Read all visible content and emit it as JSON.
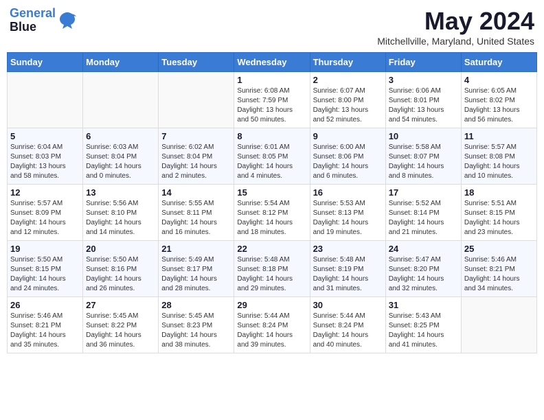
{
  "logo": {
    "line1": "General",
    "line2": "Blue"
  },
  "title": "May 2024",
  "subtitle": "Mitchellville, Maryland, United States",
  "headers": [
    "Sunday",
    "Monday",
    "Tuesday",
    "Wednesday",
    "Thursday",
    "Friday",
    "Saturday"
  ],
  "weeks": [
    [
      {
        "day": "",
        "info": ""
      },
      {
        "day": "",
        "info": ""
      },
      {
        "day": "",
        "info": ""
      },
      {
        "day": "1",
        "info": "Sunrise: 6:08 AM\nSunset: 7:59 PM\nDaylight: 13 hours\nand 50 minutes."
      },
      {
        "day": "2",
        "info": "Sunrise: 6:07 AM\nSunset: 8:00 PM\nDaylight: 13 hours\nand 52 minutes."
      },
      {
        "day": "3",
        "info": "Sunrise: 6:06 AM\nSunset: 8:01 PM\nDaylight: 13 hours\nand 54 minutes."
      },
      {
        "day": "4",
        "info": "Sunrise: 6:05 AM\nSunset: 8:02 PM\nDaylight: 13 hours\nand 56 minutes."
      }
    ],
    [
      {
        "day": "5",
        "info": "Sunrise: 6:04 AM\nSunset: 8:03 PM\nDaylight: 13 hours\nand 58 minutes."
      },
      {
        "day": "6",
        "info": "Sunrise: 6:03 AM\nSunset: 8:04 PM\nDaylight: 14 hours\nand 0 minutes."
      },
      {
        "day": "7",
        "info": "Sunrise: 6:02 AM\nSunset: 8:04 PM\nDaylight: 14 hours\nand 2 minutes."
      },
      {
        "day": "8",
        "info": "Sunrise: 6:01 AM\nSunset: 8:05 PM\nDaylight: 14 hours\nand 4 minutes."
      },
      {
        "day": "9",
        "info": "Sunrise: 6:00 AM\nSunset: 8:06 PM\nDaylight: 14 hours\nand 6 minutes."
      },
      {
        "day": "10",
        "info": "Sunrise: 5:58 AM\nSunset: 8:07 PM\nDaylight: 14 hours\nand 8 minutes."
      },
      {
        "day": "11",
        "info": "Sunrise: 5:57 AM\nSunset: 8:08 PM\nDaylight: 14 hours\nand 10 minutes."
      }
    ],
    [
      {
        "day": "12",
        "info": "Sunrise: 5:57 AM\nSunset: 8:09 PM\nDaylight: 14 hours\nand 12 minutes."
      },
      {
        "day": "13",
        "info": "Sunrise: 5:56 AM\nSunset: 8:10 PM\nDaylight: 14 hours\nand 14 minutes."
      },
      {
        "day": "14",
        "info": "Sunrise: 5:55 AM\nSunset: 8:11 PM\nDaylight: 14 hours\nand 16 minutes."
      },
      {
        "day": "15",
        "info": "Sunrise: 5:54 AM\nSunset: 8:12 PM\nDaylight: 14 hours\nand 18 minutes."
      },
      {
        "day": "16",
        "info": "Sunrise: 5:53 AM\nSunset: 8:13 PM\nDaylight: 14 hours\nand 19 minutes."
      },
      {
        "day": "17",
        "info": "Sunrise: 5:52 AM\nSunset: 8:14 PM\nDaylight: 14 hours\nand 21 minutes."
      },
      {
        "day": "18",
        "info": "Sunrise: 5:51 AM\nSunset: 8:15 PM\nDaylight: 14 hours\nand 23 minutes."
      }
    ],
    [
      {
        "day": "19",
        "info": "Sunrise: 5:50 AM\nSunset: 8:15 PM\nDaylight: 14 hours\nand 24 minutes."
      },
      {
        "day": "20",
        "info": "Sunrise: 5:50 AM\nSunset: 8:16 PM\nDaylight: 14 hours\nand 26 minutes."
      },
      {
        "day": "21",
        "info": "Sunrise: 5:49 AM\nSunset: 8:17 PM\nDaylight: 14 hours\nand 28 minutes."
      },
      {
        "day": "22",
        "info": "Sunrise: 5:48 AM\nSunset: 8:18 PM\nDaylight: 14 hours\nand 29 minutes."
      },
      {
        "day": "23",
        "info": "Sunrise: 5:48 AM\nSunset: 8:19 PM\nDaylight: 14 hours\nand 31 minutes."
      },
      {
        "day": "24",
        "info": "Sunrise: 5:47 AM\nSunset: 8:20 PM\nDaylight: 14 hours\nand 32 minutes."
      },
      {
        "day": "25",
        "info": "Sunrise: 5:46 AM\nSunset: 8:21 PM\nDaylight: 14 hours\nand 34 minutes."
      }
    ],
    [
      {
        "day": "26",
        "info": "Sunrise: 5:46 AM\nSunset: 8:21 PM\nDaylight: 14 hours\nand 35 minutes."
      },
      {
        "day": "27",
        "info": "Sunrise: 5:45 AM\nSunset: 8:22 PM\nDaylight: 14 hours\nand 36 minutes."
      },
      {
        "day": "28",
        "info": "Sunrise: 5:45 AM\nSunset: 8:23 PM\nDaylight: 14 hours\nand 38 minutes."
      },
      {
        "day": "29",
        "info": "Sunrise: 5:44 AM\nSunset: 8:24 PM\nDaylight: 14 hours\nand 39 minutes."
      },
      {
        "day": "30",
        "info": "Sunrise: 5:44 AM\nSunset: 8:24 PM\nDaylight: 14 hours\nand 40 minutes."
      },
      {
        "day": "31",
        "info": "Sunrise: 5:43 AM\nSunset: 8:25 PM\nDaylight: 14 hours\nand 41 minutes."
      },
      {
        "day": "",
        "info": ""
      }
    ]
  ]
}
